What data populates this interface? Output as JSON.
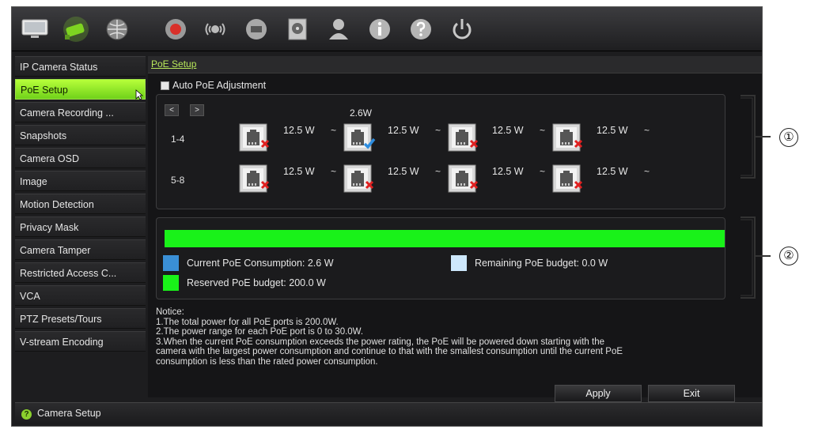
{
  "toolbar": {
    "icons": [
      "monitor-icon",
      "camera-icon",
      "network-icon",
      "record-icon",
      "alarm-icon",
      "hdd-icon",
      "storage-icon",
      "user-icon",
      "info-icon",
      "help-icon",
      "power-icon"
    ]
  },
  "sidebar": {
    "items": [
      {
        "label": "IP Camera Status"
      },
      {
        "label": "PoE Setup"
      },
      {
        "label": "Camera Recording ..."
      },
      {
        "label": "Snapshots"
      },
      {
        "label": "Camera OSD"
      },
      {
        "label": "Image"
      },
      {
        "label": "Motion Detection"
      },
      {
        "label": "Privacy Mask"
      },
      {
        "label": "Camera Tamper"
      },
      {
        "label": "Restricted Access C..."
      },
      {
        "label": "VCA"
      },
      {
        "label": "PTZ Presets/Tours"
      },
      {
        "label": "V-stream Encoding"
      }
    ],
    "active": "PoE Setup"
  },
  "main": {
    "breadcrumb": "PoE Setup",
    "auto_poe_label": "Auto PoE Adjustment",
    "pager_prev": "<",
    "pager_next": ">",
    "rows": [
      {
        "label": "1-4",
        "ports": [
          {
            "value": "12.5 W",
            "caret": "~",
            "status": "disconnected",
            "top_label": ""
          },
          {
            "value": "12.5 W",
            "caret": "~",
            "status": "connected",
            "top_label": "2.6W"
          },
          {
            "value": "12.5 W",
            "caret": "~",
            "status": "disconnected",
            "top_label": ""
          },
          {
            "value": "12.5 W",
            "caret": "~",
            "status": "disconnected",
            "top_label": ""
          }
        ]
      },
      {
        "label": "5-8",
        "ports": [
          {
            "value": "12.5 W",
            "caret": "~",
            "status": "disconnected",
            "top_label": ""
          },
          {
            "value": "12.5 W",
            "caret": "~",
            "status": "disconnected",
            "top_label": ""
          },
          {
            "value": "12.5 W",
            "caret": "~",
            "status": "disconnected",
            "top_label": ""
          },
          {
            "value": "12.5 W",
            "caret": "~",
            "status": "disconnected",
            "top_label": ""
          }
        ]
      }
    ],
    "budget": {
      "current_label": "Current PoE Consumption: 2.6 W",
      "remaining_label": "Remaining PoE budget: 0.0 W",
      "reserved_label": "Reserved PoE budget: 200.0 W",
      "colors": {
        "current": "#3a8fd6",
        "remaining": "#cde7fb",
        "reserved": "#19f219"
      }
    },
    "notice": {
      "title": "Notice:",
      "lines": [
        "1.The total power for all PoE ports is 200.0W.",
        "2.The power range for each PoE port is 0 to 30.0W.",
        "3.When the current PoE consumption exceeds the power rating, the PoE will be powered down starting with the",
        "camera with the largest power consumption and continue to that with the smallest consumption until the current PoE",
        "consumption is less than the rated power consumption."
      ]
    },
    "apply_label": "Apply",
    "exit_label": "Exit"
  },
  "statusbar": {
    "label": "Camera Setup"
  },
  "callouts": {
    "one": "①",
    "two": "②"
  }
}
